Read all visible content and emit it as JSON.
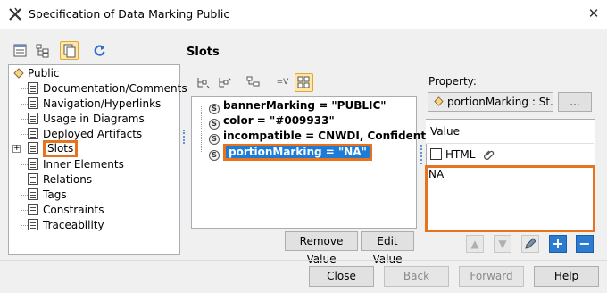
{
  "window": {
    "title": "Specification of Data Marking Public",
    "close_icon": "close-icon"
  },
  "tree": {
    "root_label": "Public",
    "items": [
      {
        "label": "Documentation/Comments"
      },
      {
        "label": "Navigation/Hyperlinks"
      },
      {
        "label": "Usage in Diagrams"
      },
      {
        "label": "Deployed Artifacts"
      },
      {
        "label": "Slots",
        "selected": true
      },
      {
        "label": "Inner Elements"
      },
      {
        "label": "Relations"
      },
      {
        "label": "Tags"
      },
      {
        "label": "Constraints"
      },
      {
        "label": "Traceability"
      }
    ]
  },
  "slots": {
    "title": "Slots",
    "rows": [
      {
        "label": "bannerMarking = \"PUBLIC\""
      },
      {
        "label": "color = \"#009933\""
      },
      {
        "label": "incompatible = CNWDI, Confidential"
      },
      {
        "label": "portionMarking = \"NA\"",
        "selected": true
      }
    ],
    "remove_value_label": "Remove Value",
    "edit_value_label": "Edit Value"
  },
  "property": {
    "label": "Property:",
    "combo_value": "portionMarking : St...",
    "ellipsis_label": "..."
  },
  "value_editor": {
    "header": "Value",
    "html_label": "HTML",
    "html_checked": false,
    "text": "NA"
  },
  "footer": {
    "close_label": "Close",
    "back_label": "Back",
    "forward_label": "Forward",
    "help_label": "Help"
  },
  "colors": {
    "highlight_orange": "#e8731c",
    "selection_blue": "#1e7cd6",
    "dialog_bg": "#f0f0f0"
  }
}
